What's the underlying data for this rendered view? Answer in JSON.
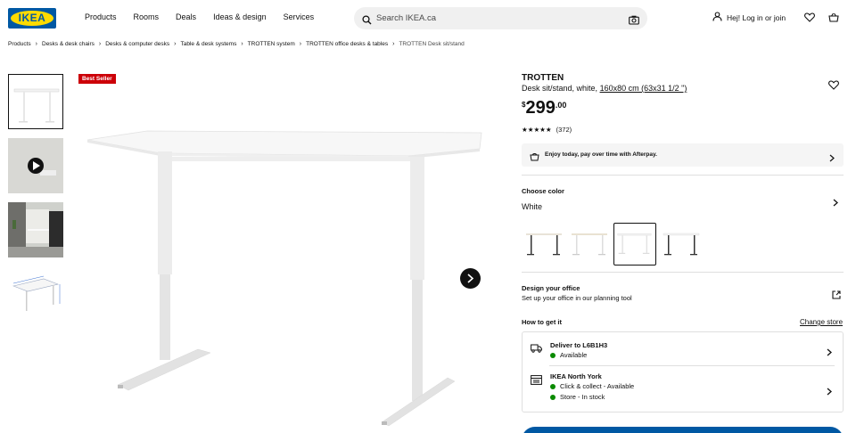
{
  "header": {
    "logo_text": "IKEA",
    "nav": [
      "Products",
      "Rooms",
      "Deals",
      "Ideas & design",
      "Services"
    ],
    "search_placeholder": "Search IKEA.ca",
    "login_label": "Hej! Log in or join"
  },
  "breadcrumb": [
    "Products",
    "Desks & desk chairs",
    "Desks & computer desks",
    "Table & desk systems",
    "TROTTEN system",
    "TROTTEN office desks & tables",
    "TROTTEN Desk sit/stand"
  ],
  "product": {
    "badge": "Best Seller",
    "name": "TROTTEN",
    "desc_prefix": "Desk sit/stand, white,",
    "desc_size": "160x80 cm (63x31 1/2 \")",
    "price_currency": "$",
    "price_int": "299",
    "price_dec": ".00",
    "rating_stars": 4.5,
    "rating_count": "(372)",
    "afterpay_text": "Enjoy today, pay over time with Afterpay.",
    "choose_color_label": "Choose color",
    "color_value": "White",
    "swatches": [
      "white/anthracite",
      "beige/white",
      "white",
      "white/anthracite-frame"
    ],
    "design_title": "Design your office",
    "design_sub": "Set up your office in our planning tool",
    "how_to_label": "How to get it",
    "change_store": "Change store",
    "delivery": {
      "title": "Deliver to L6B1H3",
      "status": "Available"
    },
    "store": {
      "title": "IKEA North York",
      "line1": "Click & collect - Available",
      "line2": "Store - In stock"
    }
  },
  "colors": {
    "brand_blue": "#0058a3",
    "brand_yellow": "#ffdb00",
    "badge_red": "#cc0008",
    "available_green": "#0a8a00"
  }
}
